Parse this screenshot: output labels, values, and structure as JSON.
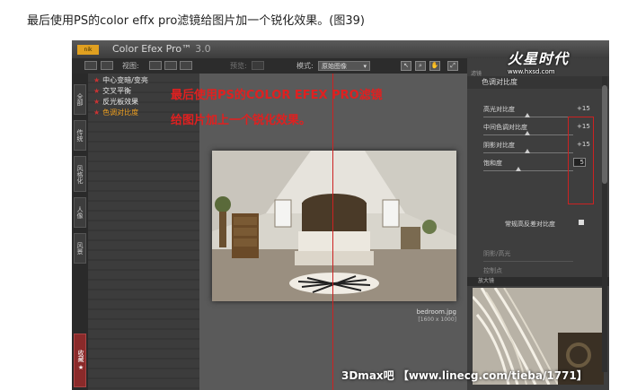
{
  "caption": "最后使用PS的color effx pro滤镜给图片加一个锐化效果。(图39)",
  "app": {
    "logo_badge": "nik",
    "title": "Color Efex Pro™",
    "version": "3.0"
  },
  "toolbar": {
    "view_label": "视图:",
    "preview_label": "预览:",
    "mode_label": "模式:",
    "mode_value": "原始图像"
  },
  "left_tabs": [
    "全部",
    "传统",
    "风格化",
    "人像",
    "风景"
  ],
  "bottom_tab": "收藏",
  "filters": [
    {
      "label": "中心变暗/变亮",
      "active": false
    },
    {
      "label": "交叉平衡",
      "active": false
    },
    {
      "label": "反光板效果",
      "active": false
    },
    {
      "label": "色调对比度",
      "active": true
    }
  ],
  "overlay": {
    "line1": "最后使用PS的COLOR EFEX PRO滤镜",
    "line2": "给图片加上一个锐化效果。"
  },
  "preview": {
    "filename": "bedroom.jpg",
    "dimensions": "[1600 x 1000]"
  },
  "right_panel": {
    "section_header": "滤镜",
    "filter_title": "色调对比度",
    "sliders": [
      {
        "label": "高光对比度",
        "value": "+15"
      },
      {
        "label": "中间色调对比度",
        "value": "+15"
      },
      {
        "label": "阴影对比度",
        "value": "+15"
      },
      {
        "label": "饱和度",
        "value": "5"
      }
    ],
    "checkbox_label": "常规高反差对比度",
    "dim_items": [
      "阴影/高光",
      "控制点"
    ],
    "loupe_label": "放大镜"
  },
  "watermarks": {
    "logo": "火星时代",
    "url": "www.hxsd.com",
    "bottom": "3Dmax吧 【www.linecg.com/tieba/1771】"
  }
}
